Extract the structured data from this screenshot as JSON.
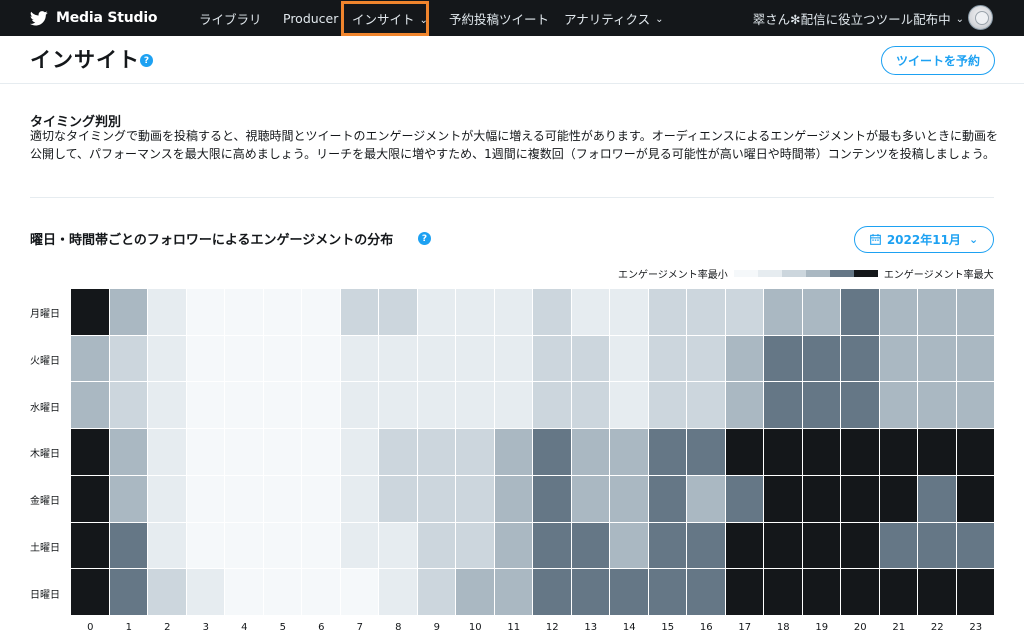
{
  "nav": {
    "brand": "Media Studio",
    "items": [
      {
        "label": "ライブラリ",
        "dropdown": false
      },
      {
        "label": "Producer",
        "dropdown": false
      },
      {
        "label": "インサイト",
        "dropdown": true,
        "active": true
      },
      {
        "label": "予約投稿ツイート",
        "dropdown": false
      },
      {
        "label": "アナリティクス",
        "dropdown": true
      }
    ],
    "account": "翠さん✻配信に役立つツール配布中"
  },
  "page": {
    "title": "インサイト",
    "schedule_button": "ツイートを予約"
  },
  "timing": {
    "title": "タイミング判別",
    "description": "適切なタイミングで動画を投稿すると、視聴時間とツイートのエンゲージメントが大幅に増える可能性があります。オーディエンスによるエンゲージメントが最も多いときに動画を公開して、パフォーマンスを最大限に高めましょう。リーチを最大限に増やすため、1週間に複数回（フォロワーが見る可能性が高い曜日や時間帯）コンテンツを投稿しましょう。"
  },
  "chart_section": {
    "title": "曜日・時間帯ごとのフォロワーによるエンゲージメントの分布",
    "month_button": "2022年11月",
    "legend_min": "エンゲージメント率最小",
    "legend_max": "エンゲージメント率最大"
  },
  "colors": {
    "accent": "#1da1f2",
    "nav_bg": "#14171a",
    "active_highlight": "#f0852d",
    "scale": [
      "#f5f8fa",
      "#e6ecf0",
      "#ccd6dd",
      "#aab8c2",
      "#657786",
      "#14171a"
    ]
  },
  "chart_data": {
    "type": "heatmap",
    "title": "曜日・時間帯ごとのフォロワーによるエンゲージメントの分布",
    "rows": [
      "月曜日",
      "火曜日",
      "水曜日",
      "木曜日",
      "金曜日",
      "土曜日",
      "日曜日"
    ],
    "columns": [
      "0",
      "1",
      "2",
      "3",
      "4",
      "5",
      "6",
      "7",
      "8",
      "9",
      "10",
      "11",
      "12",
      "13",
      "14",
      "15",
      "16",
      "17",
      "18",
      "19",
      "20",
      "21",
      "22",
      "23"
    ],
    "scale_levels": 6,
    "legend_min_label": "エンゲージメント率最小",
    "legend_max_label": "エンゲージメント率最大",
    "values": [
      [
        5,
        3,
        1,
        0,
        0,
        0,
        0,
        2,
        2,
        1,
        1,
        1,
        2,
        1,
        1,
        2,
        2,
        2,
        3,
        3,
        4,
        3,
        3,
        3
      ],
      [
        3,
        2,
        1,
        0,
        0,
        0,
        0,
        1,
        1,
        1,
        1,
        1,
        2,
        2,
        1,
        2,
        2,
        3,
        4,
        4,
        4,
        3,
        3,
        3
      ],
      [
        3,
        2,
        1,
        0,
        0,
        0,
        0,
        1,
        1,
        1,
        1,
        1,
        2,
        2,
        1,
        2,
        2,
        3,
        4,
        4,
        4,
        3,
        3,
        3
      ],
      [
        5,
        3,
        1,
        0,
        0,
        0,
        0,
        1,
        2,
        2,
        2,
        3,
        4,
        3,
        3,
        4,
        4,
        5,
        5,
        5,
        5,
        5,
        5,
        5
      ],
      [
        5,
        3,
        1,
        0,
        0,
        0,
        0,
        1,
        2,
        2,
        2,
        3,
        4,
        3,
        3,
        4,
        3,
        4,
        5,
        5,
        5,
        5,
        4,
        5
      ],
      [
        5,
        4,
        1,
        0,
        0,
        0,
        0,
        1,
        1,
        2,
        2,
        3,
        4,
        4,
        3,
        4,
        4,
        5,
        5,
        5,
        5,
        4,
        4,
        4
      ],
      [
        5,
        4,
        2,
        1,
        0,
        0,
        0,
        0,
        1,
        2,
        3,
        3,
        4,
        4,
        4,
        4,
        4,
        5,
        5,
        5,
        5,
        5,
        5,
        5
      ]
    ]
  }
}
